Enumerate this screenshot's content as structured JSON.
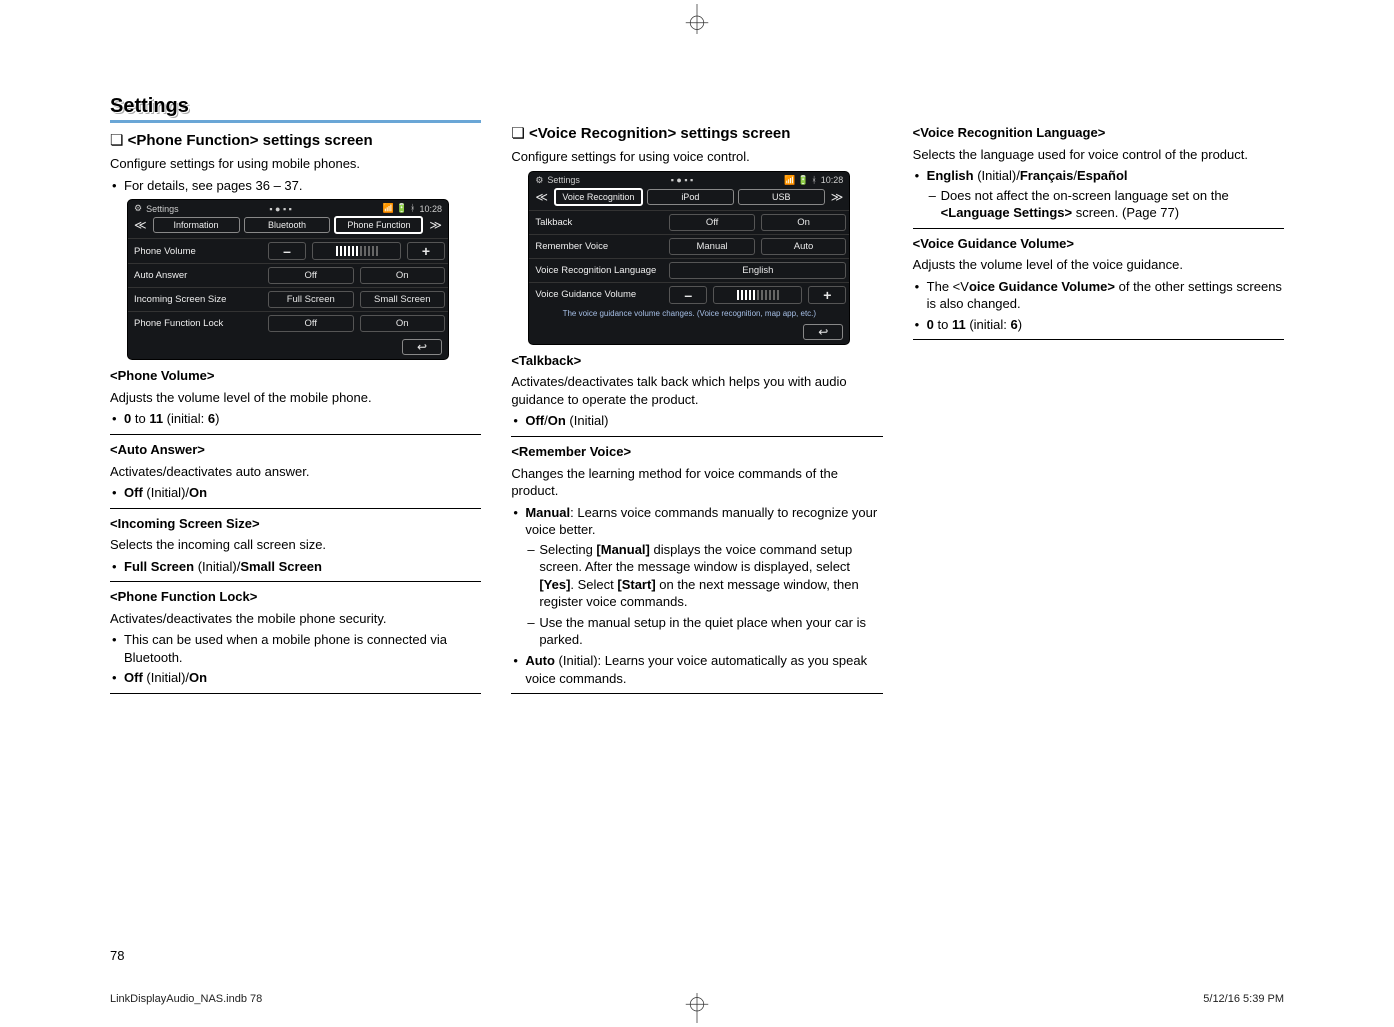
{
  "page": {
    "section_title": "Settings",
    "page_number": "78",
    "footer_file": "LinkDisplayAudio_NAS.indb   78",
    "footer_date": "5/12/16   5:39 PM"
  },
  "col1": {
    "title": "<Phone Function> settings screen",
    "intro": "Configure settings for using mobile phones.",
    "details_line": "For details, see pages 36 – 37.",
    "fig": {
      "header": "Settings",
      "time": "10:28",
      "tabs": [
        "Information",
        "Bluetooth",
        "Phone Function"
      ],
      "rows": {
        "phone_volume": "Phone Volume",
        "auto_answer": "Auto Answer",
        "auto_answer_opts": [
          "Off",
          "On"
        ],
        "incoming": "Incoming Screen Size",
        "incoming_opts": [
          "Full Screen",
          "Small Screen"
        ],
        "lock": "Phone Function Lock",
        "lock_opts": [
          "Off",
          "On"
        ]
      }
    },
    "phone_volume": {
      "h": "<Phone Volume>",
      "desc": "Adjusts the volume level of the mobile phone.",
      "range_pre": "0",
      "range_mid": " to ",
      "range_b": "11",
      "range_post": " (initial: ",
      "range_init": "6",
      "range_close": ")"
    },
    "auto_answer": {
      "h": "<Auto Answer>",
      "desc": "Activates/deactivates auto answer.",
      "opt_off": "Off",
      "opt_initial": " (Initial)/",
      "opt_on": "On"
    },
    "incoming": {
      "h": "<Incoming Screen Size>",
      "desc": "Selects the incoming call screen size.",
      "opt1": "Full Screen",
      "opt_mid": " (Initial)/",
      "opt2": "Small Screen"
    },
    "lock": {
      "h": "<Phone Function Lock>",
      "desc": "Activates/deactivates the mobile phone security.",
      "b1": "This can be used when a mobile phone is connected via Bluetooth.",
      "opt_off": "Off",
      "opt_mid": " (Initial)/",
      "opt_on": "On"
    }
  },
  "col2": {
    "title": "<Voice Recognition> settings screen",
    "intro": "Configure settings for using voice control.",
    "fig": {
      "header": "Settings",
      "time": "10:28",
      "tabs": [
        "Voice Recognition",
        "iPod",
        "USB"
      ],
      "rows": {
        "talkback": "Talkback",
        "talkback_opts": [
          "Off",
          "On"
        ],
        "remember": "Remember Voice",
        "remember_opts": [
          "Manual",
          "Auto"
        ],
        "lang": "Voice Recognition Language",
        "lang_val": "English",
        "guidance": "Voice Guidance Volume"
      },
      "hint": "The voice guidance volume changes. (Voice recognition, map app, etc.)"
    },
    "talkback": {
      "h": "<Talkback>",
      "desc": "Activates/deactivates talk back which helps you with audio guidance to operate the product.",
      "opt_off": "Off",
      "sep": "/",
      "opt_on": "On",
      "opt_initial": " (Initial)"
    },
    "remember": {
      "h": "<Remember Voice>",
      "desc": "Changes the learning method for voice commands of the product.",
      "manual_label": "Manual",
      "manual_desc": ": Learns voice commands manually to recognize your voice better.",
      "manual_sub1a": "Selecting ",
      "manual_sub1b": "[Manual]",
      "manual_sub1c": " displays the voice command setup screen. After the message window is displayed, select ",
      "manual_sub1d": "[Yes]",
      "manual_sub1e": ". Select ",
      "manual_sub1f": "[Start]",
      "manual_sub1g": " on the next message window, then register voice commands.",
      "manual_sub2": "Use the manual setup in the quiet place when your car is parked.",
      "auto_label": "Auto",
      "auto_desc": " (Initial): Learns your voice automatically as you speak voice commands."
    }
  },
  "col3": {
    "lang": {
      "h": "<Voice Recognition Language>",
      "desc": "Selects the language used for voice control of the product.",
      "opt1": "English",
      "opt1_initial": " (Initial)/",
      "opt2": "Français",
      "sep": "/",
      "opt3": "Español",
      "sub_a": "Does not affect the on-screen language set on the ",
      "sub_b": "<Language Settings>",
      "sub_c": " screen. (Page 77)"
    },
    "guidance": {
      "h": "<Voice Guidance Volume>",
      "desc": "Adjusts the volume level of the voice guidance.",
      "b1a": "The <V",
      "b1b": "oice Guidance Volume>",
      "b1c": " of the other settings screens is also changed.",
      "range_pre": "0",
      "range_mid": " to ",
      "range_b": "11",
      "range_post": " (initial: ",
      "range_init": "6",
      "range_close": ")"
    }
  }
}
